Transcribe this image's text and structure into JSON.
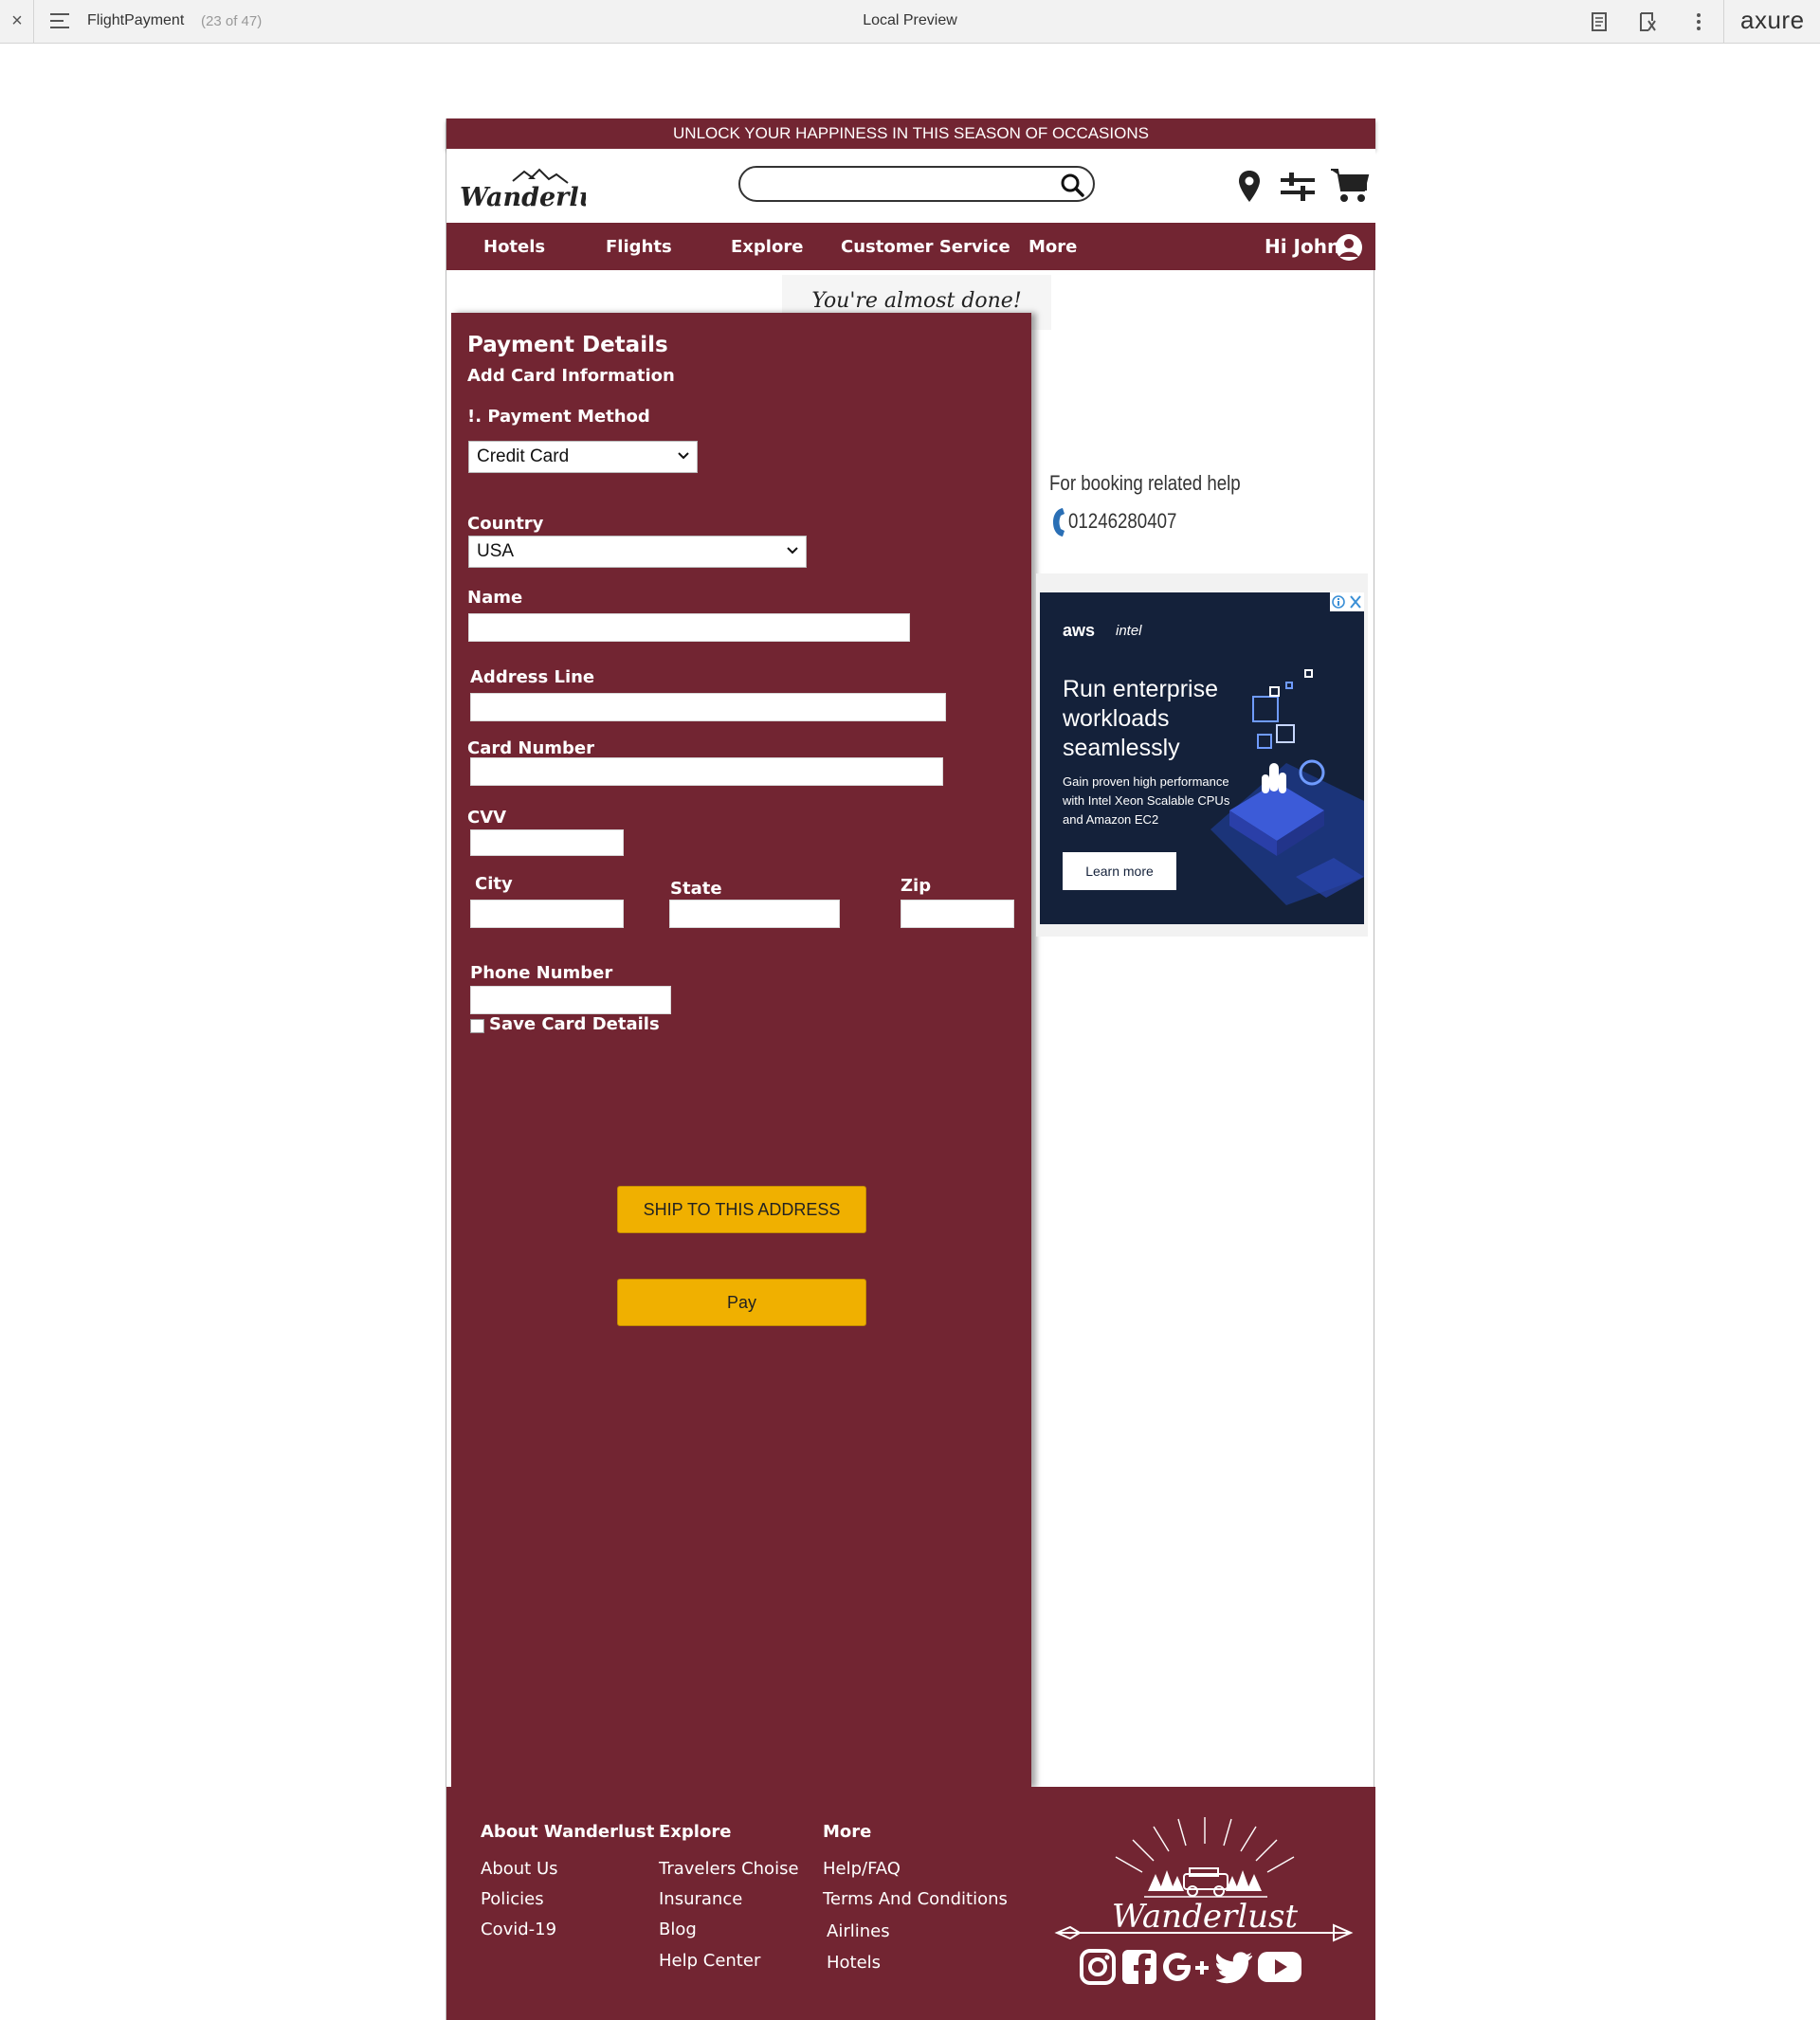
{
  "axure": {
    "page_name": "FlightPayment",
    "page_count": "(23 of 47)",
    "preview_title": "Local Preview",
    "brand": "axure"
  },
  "promo": {
    "text": "UNLOCK YOUR HAPPINESS IN THIS SEASON OF OCCASIONS"
  },
  "header": {
    "logo_text": "Wanderlust",
    "search_placeholder": ""
  },
  "nav": {
    "items": [
      "Hotels",
      "Flights",
      "Explore",
      "Customer Service",
      "More"
    ],
    "greeting": "Hi John"
  },
  "banner": {
    "almost_done": "You're almost done!"
  },
  "payment": {
    "title": "Payment Details",
    "subtitle": "Add Card Information",
    "method_label": "!. Payment Method",
    "method_value": "Credit Card",
    "country_label": "Country",
    "country_value": "USA",
    "name_label": "Name",
    "address_label": "Address Line",
    "card_label": "Card Number",
    "cvv_label": "CVV",
    "city_label": "City",
    "state_label": "State",
    "zip_label": "Zip",
    "phone_label": "Phone Number",
    "save_label": "Save Card Details",
    "ship_button": "SHIP TO THIS ADDRESS",
    "pay_button": "Pay"
  },
  "help": {
    "title": "For booking related help",
    "phone": "01246280407"
  },
  "ad": {
    "brand1": "aws",
    "brand2": "intel",
    "headline_1": "Run enterprise",
    "headline_2": "workloads",
    "headline_3": "seamlessly",
    "body_1": "Gain proven high performance",
    "body_2": "with Intel Xeon Scalable CPUs",
    "body_3": "and Amazon EC2",
    "cta": "Learn more"
  },
  "footer": {
    "col1": {
      "heading": "About Wanderlust",
      "links": [
        "About Us",
        "Policies",
        "Covid-19"
      ]
    },
    "col2": {
      "heading": "Explore",
      "links": [
        "Travelers Choise",
        "Insurance",
        "Blog",
        "Help Center"
      ]
    },
    "col3": {
      "heading": "More",
      "links": [
        "Help/FAQ",
        "Terms And Conditions",
        "Airlines",
        "Hotels"
      ]
    },
    "logo_text": "Wanderlust",
    "social": [
      "instagram-icon",
      "facebook-icon",
      "google-plus-icon",
      "twitter-icon",
      "youtube-icon"
    ]
  },
  "colors": {
    "brand": "#722532",
    "button": "#f0b000",
    "ad_bg": "#14213a"
  }
}
